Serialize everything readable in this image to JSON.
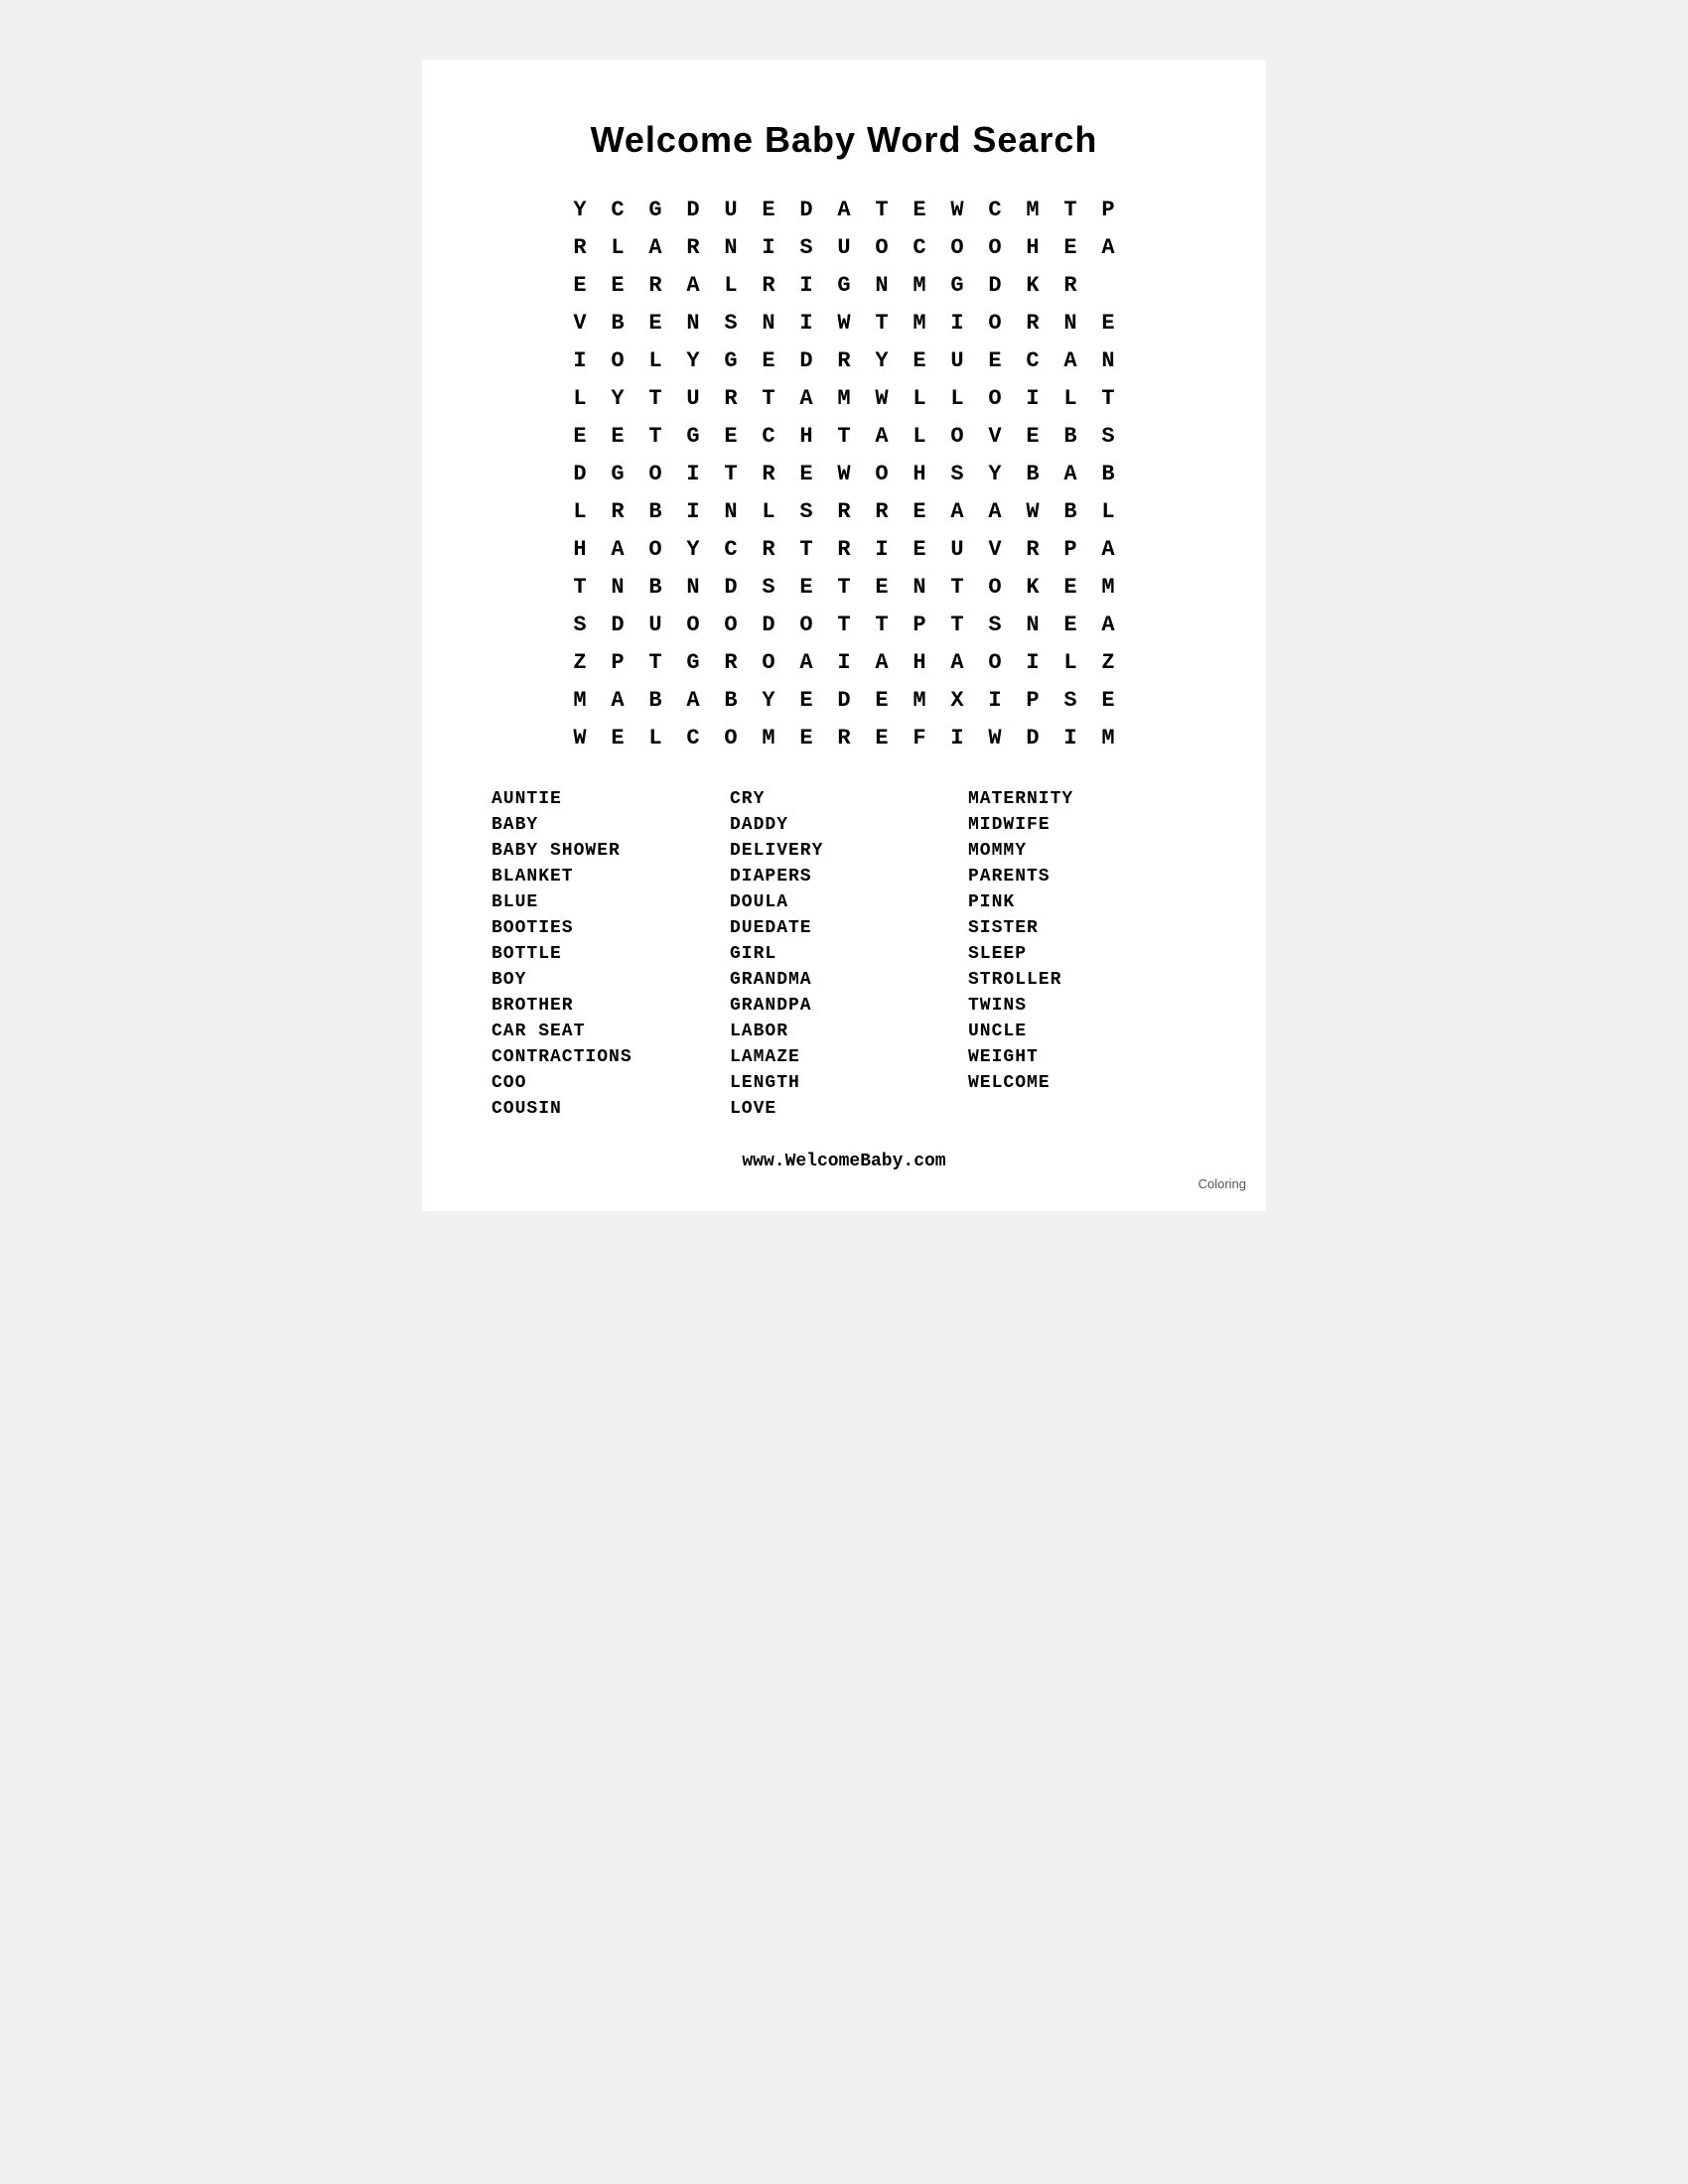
{
  "page": {
    "title": "Welcome Baby Word Search",
    "grid": [
      [
        "Y",
        "C",
        "G",
        "D",
        "U",
        "E",
        "D",
        "A",
        "T",
        "E",
        "W",
        "C",
        "M",
        "T",
        "P"
      ],
      [
        "R",
        "L",
        "A",
        "R",
        "N",
        "I",
        "S",
        "U",
        "O",
        "C",
        "O",
        "O",
        "H",
        "E",
        "A"
      ],
      [
        "E",
        "E",
        "R",
        "A",
        "L",
        "R",
        "I",
        "G",
        "N",
        "M",
        "G",
        "D",
        "K",
        "R",
        ""
      ],
      [
        "V",
        "B",
        "E",
        "N",
        "S",
        "N",
        "I",
        "W",
        "T",
        "M",
        "I",
        "O",
        "R",
        "N",
        "E"
      ],
      [
        "I",
        "O",
        "L",
        "Y",
        "G",
        "E",
        "D",
        "R",
        "Y",
        "E",
        "U",
        "E",
        "C",
        "A",
        "N"
      ],
      [
        "L",
        "Y",
        "T",
        "U",
        "R",
        "T",
        "A",
        "M",
        "W",
        "L",
        "L",
        "O",
        "I",
        "L",
        "T"
      ],
      [
        "E",
        "E",
        "T",
        "G",
        "E",
        "C",
        "H",
        "T",
        "A",
        "L",
        "O",
        "V",
        "E",
        "B",
        "S"
      ],
      [
        "D",
        "G",
        "O",
        "I",
        "T",
        "R",
        "E",
        "W",
        "O",
        "H",
        "S",
        "Y",
        "B",
        "A",
        "B"
      ],
      [
        "L",
        "R",
        "B",
        "I",
        "N",
        "L",
        "S",
        "R",
        "R",
        "E",
        "A",
        "A",
        "W",
        "B",
        "L"
      ],
      [
        "H",
        "A",
        "O",
        "Y",
        "C",
        "R",
        "T",
        "R",
        "I",
        "E",
        "U",
        "V",
        "R",
        "P",
        "A"
      ],
      [
        "T",
        "N",
        "B",
        "N",
        "D",
        "S",
        "E",
        "T",
        "E",
        "N",
        "T",
        "O",
        "K",
        "E",
        "M"
      ],
      [
        "S",
        "D",
        "U",
        "O",
        "O",
        "D",
        "O",
        "T",
        "T",
        "P",
        "T",
        "S",
        "N",
        "E",
        "A"
      ],
      [
        "Z",
        "P",
        "T",
        "G",
        "R",
        "O",
        "A",
        "I",
        "A",
        "H",
        "A",
        "O",
        "I",
        "L",
        "Z"
      ],
      [
        "M",
        "A",
        "B",
        "A",
        "B",
        "Y",
        "E",
        "D",
        "E",
        "M",
        "X",
        "I",
        "P",
        "S",
        "E"
      ],
      [
        "W",
        "E",
        "L",
        "C",
        "O",
        "M",
        "E",
        "R",
        "E",
        "F",
        "I",
        "W",
        "D",
        "I",
        "M"
      ]
    ],
    "words": {
      "col1": [
        "AUNTIE",
        "BABY",
        "BABY SHOWER",
        "BLANKET",
        "BLUE",
        "BOOTIES",
        "BOTTLE",
        "BOY",
        "BROTHER",
        "CAR SEAT",
        "CONTRACTIONS",
        "COO",
        "COUSIN"
      ],
      "col2": [
        "CRY",
        "DADDY",
        "DELIVERY",
        "DIAPERS",
        "DOULA",
        "DUEDATE",
        "GIRL",
        "GRANDMA",
        "GRANDPA",
        "LABOR",
        "LAMAZE",
        "LENGTH",
        "LOVE"
      ],
      "col3": [
        "MATERNITY",
        "MIDWIFE",
        "MOMMY",
        "PARENTS",
        "PINK",
        "SISTER",
        "SLEEP",
        "STROLLER",
        "TWINS",
        "UNCLE",
        "WEIGHT",
        "WELCOME",
        ""
      ]
    },
    "footer": "www.WelcomeBaby.com",
    "coloring_label": "Coloring"
  }
}
